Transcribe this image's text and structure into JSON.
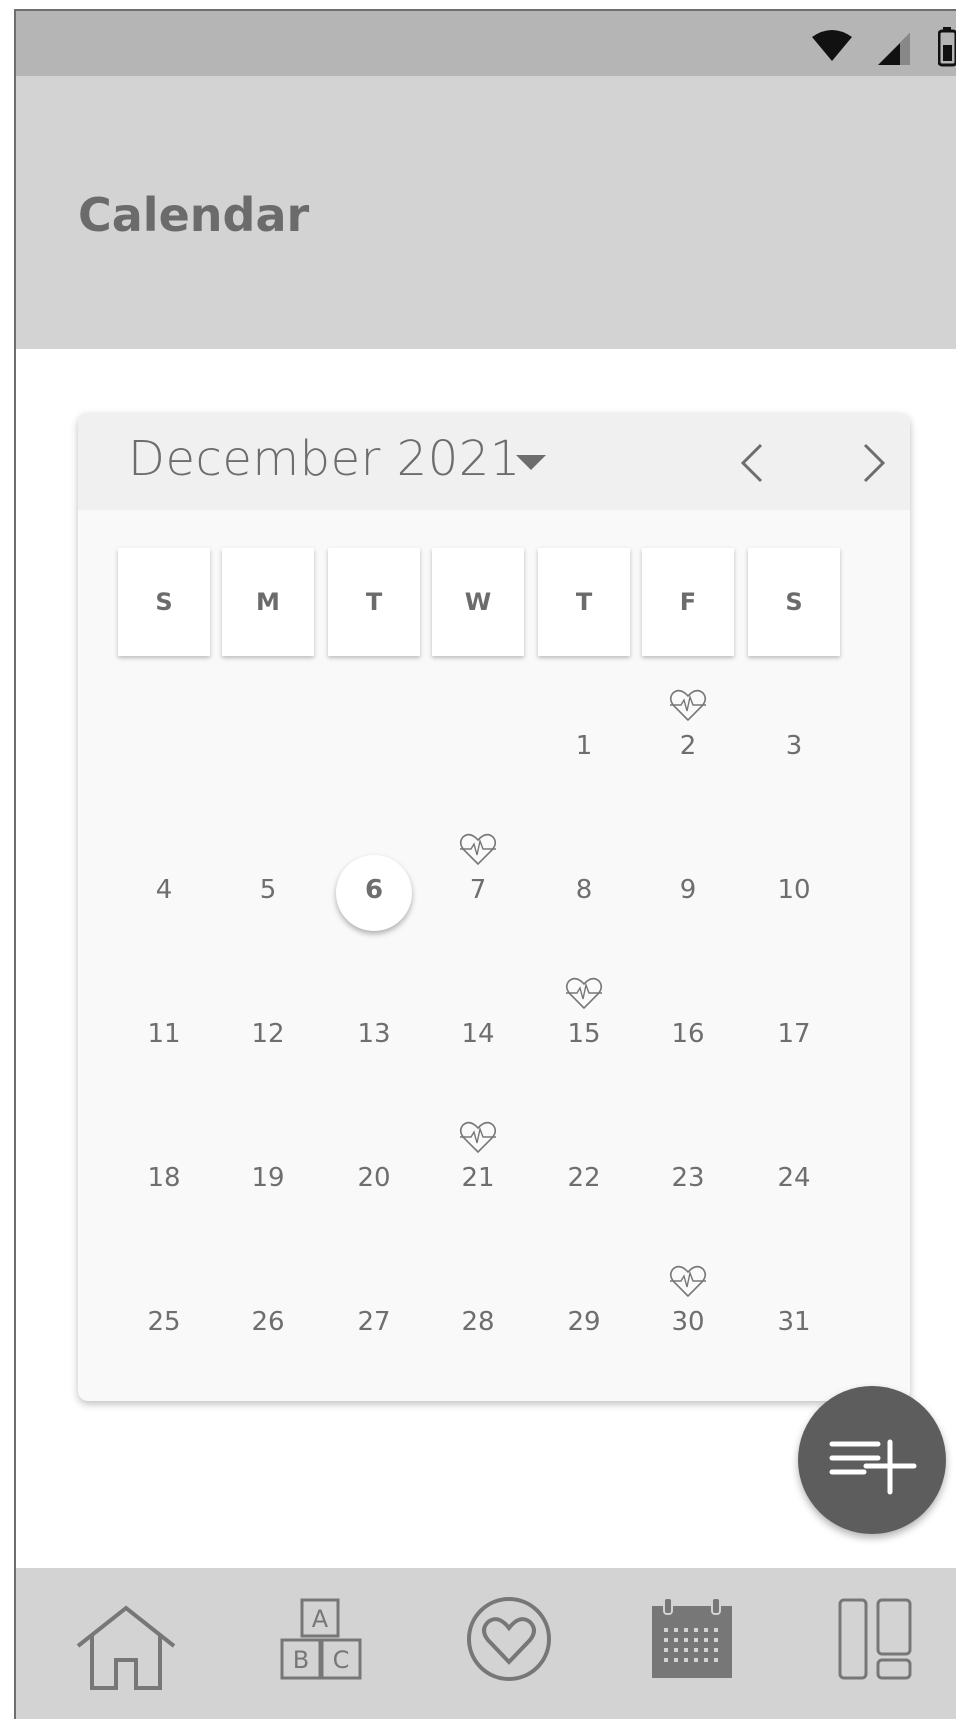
{
  "app": {
    "title": "Calendar"
  },
  "status_bar": {
    "icons": [
      "wifi-icon",
      "cell-signal-icon",
      "battery-icon"
    ]
  },
  "calendar": {
    "month_label": "December 2021",
    "weekdays": [
      "S",
      "M",
      "T",
      "W",
      "T",
      "F",
      "S"
    ],
    "today": "6",
    "weeks": [
      [
        "",
        "",
        "",
        "",
        "1",
        "2",
        "3"
      ],
      [
        "4",
        "5",
        "6",
        "7",
        "8",
        "9",
        "10"
      ],
      [
        "11",
        "12",
        "13",
        "14",
        "15",
        "16",
        "17"
      ],
      [
        "18",
        "19",
        "20",
        "21",
        "22",
        "23",
        "24"
      ],
      [
        "25",
        "26",
        "27",
        "28",
        "29",
        "30",
        "31"
      ]
    ],
    "heart_days": [
      "2",
      "7",
      "15",
      "21",
      "30"
    ]
  },
  "bottom_nav": {
    "items": [
      "home-icon",
      "alphabet-blocks-icon",
      "heart-icon",
      "calendar-icon",
      "layout-icon"
    ]
  },
  "colors": {
    "header_bg": "#d3d3d3",
    "status_bg": "#b5b5b5",
    "fab_bg": "#5d5d5d",
    "text": "#6d6d6d"
  }
}
